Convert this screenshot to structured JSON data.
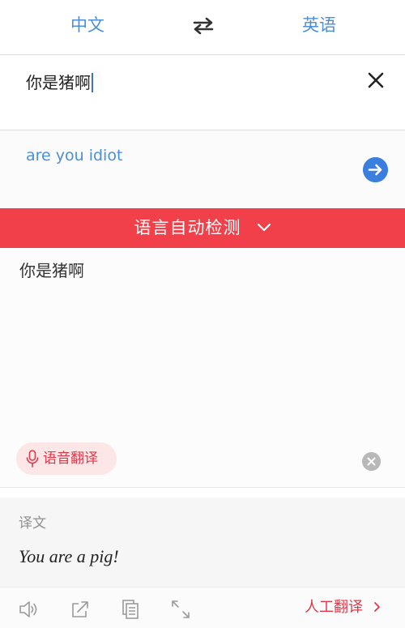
{
  "language_bar": {
    "source_language": "中文",
    "target_language": "英语",
    "swap_icon": "swap-arrows-icon"
  },
  "input": {
    "value": "你是猪啊",
    "clear_icon": "close-icon"
  },
  "suggestion": {
    "text": "are you idiot",
    "go_icon": "arrow-right-circle-icon"
  },
  "detect_bar": {
    "label": "语言自动检测",
    "icon": "chevron-down-icon"
  },
  "source": {
    "text": "你是猪啊",
    "voice_button_label": "语音翻译",
    "voice_icon": "microphone-icon",
    "clear_icon": "clear-circle-icon"
  },
  "result": {
    "label": "译文",
    "text": "You are a pig!"
  },
  "toolbar": {
    "icons": [
      "speaker-icon",
      "share-icon",
      "copy-icon",
      "expand-icon"
    ],
    "human_translate_label": "人工翻译"
  },
  "colors": {
    "accent_blue": "#4a8fd8",
    "detect_red": "#f2404a",
    "human_red": "#e0384a",
    "voice_pill_bg": "#fde7e6"
  }
}
